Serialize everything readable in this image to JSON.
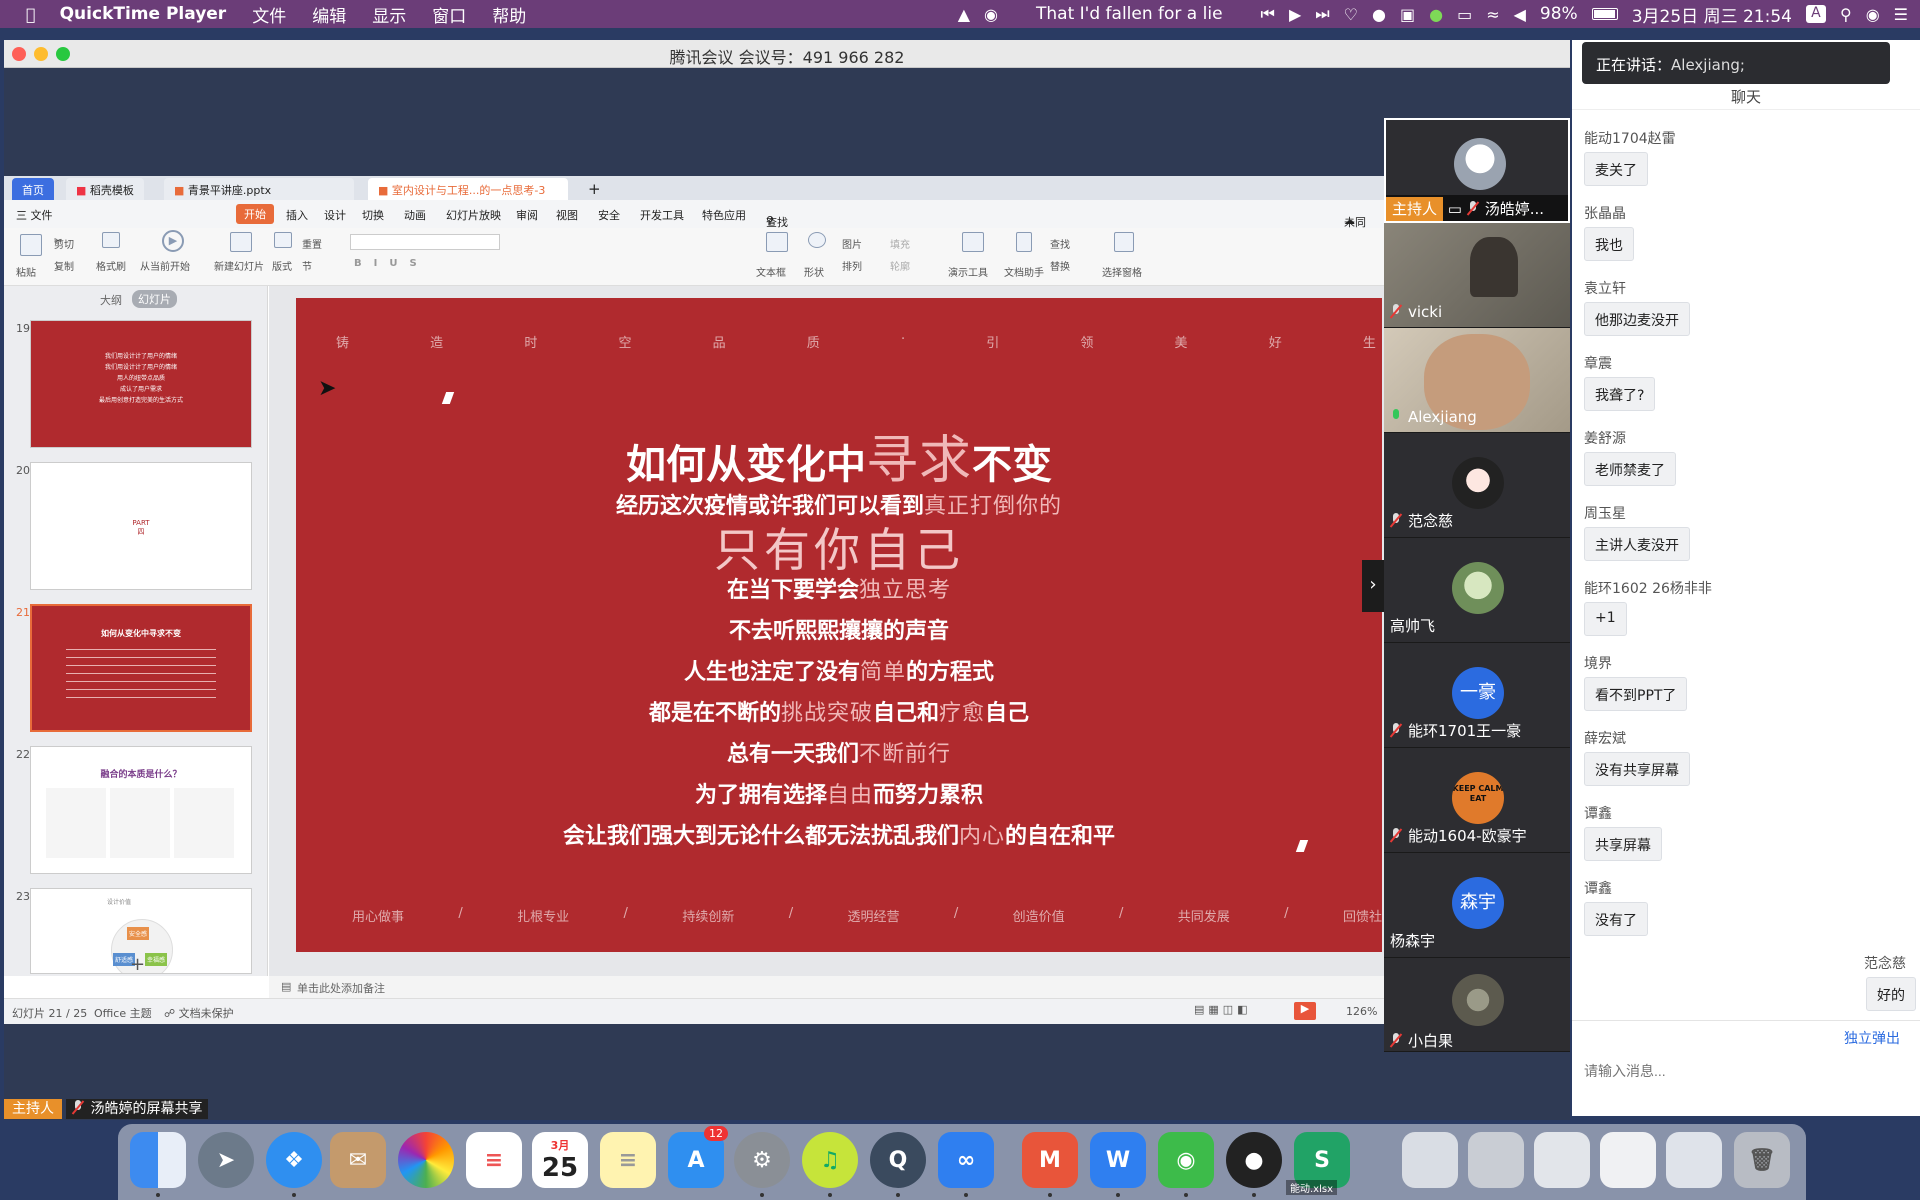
{
  "menubar": {
    "app_name": "QuickTime Player",
    "items": [
      "文件",
      "编辑",
      "显示",
      "窗口",
      "帮助"
    ],
    "now_playing": "That I'd fallen for a lie",
    "battery": "98%",
    "datetime": "3月25日 周三 21:54",
    "input_method": "A"
  },
  "window": {
    "title": "腾讯会议 会议号：491 966 282"
  },
  "wps": {
    "tabs": [
      "首页",
      "稻壳模板",
      "青景平讲座.pptx",
      "室内设计与工程...的一点思考-3"
    ],
    "menu": [
      "三 文件",
      "开始",
      "插入",
      "设计",
      "切换",
      "动画",
      "幻灯片放映",
      "审阅",
      "视图",
      "安全",
      "开发工具",
      "特色应用",
      "查找"
    ],
    "sync_label": "未同",
    "ribbon": {
      "paste": "粘贴",
      "cut": "剪切",
      "copy": "复制",
      "format_painter": "格式刷",
      "from_current": "从当前开始",
      "new_slide": "新建幻灯片",
      "layout": "版式",
      "reset": "重置",
      "section": "节",
      "textbox": "文本框",
      "shape": "形状",
      "picture": "图片",
      "arrange": "排列",
      "fill": "填充",
      "outline": "轮廓",
      "present_tool": "演示工具",
      "doc_helper": "文档助手",
      "find": "查找",
      "replace": "替换",
      "select_pane": "选择窗格"
    },
    "panel_tabs": [
      "大纲",
      "幻灯片"
    ],
    "thumbnails": [
      {
        "num": "19",
        "lines": [
          "我们用设计计了用户的情绪",
          "我们用设计计了用户的情绪",
          "用人的纽带点品质",
          "成认了用户需求",
          "最后用创意打造完美的生活方式"
        ]
      },
      {
        "num": "20",
        "lines": [
          "PART",
          "四"
        ]
      },
      {
        "num": "21",
        "lines": [
          "如何从变化中寻求不变"
        ]
      },
      {
        "num": "22",
        "lines": [
          "融合的本质是什么？"
        ]
      },
      {
        "num": "23",
        "lines": [
          "设计价值",
          "安全感",
          "舒适感",
          "幸福感"
        ]
      }
    ],
    "notes_placeholder": "单击此处添加备注",
    "status": {
      "slide_pos": "幻灯片 21 / 25",
      "theme": "Office 主题",
      "protect": "文档未保护",
      "zoom": "126%"
    }
  },
  "slide": {
    "top_slogan": [
      "铸",
      "造",
      "时",
      "空",
      "品",
      "质",
      "·",
      "引",
      "领",
      "美",
      "好",
      "生"
    ],
    "title_pre": "如何从变化中",
    "title_hl": "寻求",
    "title_post": "不变",
    "lines": [
      {
        "pre": "经历这次疫情或许我们可以看到",
        "hl": "真正打倒你的",
        "post": ""
      },
      {
        "pre": "在当下要学会",
        "hl": "独立思考",
        "post": ""
      },
      {
        "pre": "不去听熙熙攘攘的声音",
        "hl": "",
        "post": ""
      },
      {
        "pre": "人生也注定了没有",
        "hl": "简单",
        "post": "的方程式"
      },
      {
        "pre": "都是在不断的",
        "hl": "挑战突破",
        "post": "自己和",
        "hl2": "疗愈",
        "post2": "自己"
      },
      {
        "pre": "总有一天我们",
        "hl": "不断前行",
        "post": ""
      },
      {
        "pre": "为了拥有选择",
        "hl": "自由",
        "post": "而努力累积"
      },
      {
        "pre": "会让我们强大到无论什么都无法扰乱我们",
        "hl": "内心",
        "post": "的自在和平"
      }
    ],
    "big_line": "只有你自己",
    "bottom_slogan": [
      "用心做事",
      "/",
      "扎根专业",
      "/",
      "持续创新",
      "/",
      "透明经营",
      "/",
      "创造价值",
      "/",
      "共同发展",
      "/",
      "回馈社"
    ]
  },
  "participants": [
    {
      "name": "汤皓婷...",
      "role": "主持人",
      "mic": "off"
    },
    {
      "name": "vicki",
      "mic": "off"
    },
    {
      "name": "Alexjiang",
      "mic": "on"
    },
    {
      "name": "范念慈",
      "mic": "off"
    },
    {
      "name": "高帅飞",
      "mic": "none"
    },
    {
      "name": "能环1701王一豪",
      "mic": "off",
      "avatar_text": "一豪"
    },
    {
      "name": "能动1604-欧豪宇",
      "mic": "off",
      "avatar_text": "KEEP CALM EAT"
    },
    {
      "name": "杨森宇",
      "mic": "none",
      "avatar_text": "森宇"
    },
    {
      "name": "小白果",
      "mic": "off"
    }
  ],
  "share_bar": {
    "role": "主持人",
    "text": "汤皓婷的屏幕共享"
  },
  "chat": {
    "speaking": "正在讲话：",
    "speaking_name": "Alexjiang;",
    "header": "聊天",
    "messages": [
      {
        "name": "能动1704赵雷",
        "text": "麦关了"
      },
      {
        "name": "张晶晶",
        "text": "我也"
      },
      {
        "name": "袁立轩",
        "text": "他那边麦没开"
      },
      {
        "name": "章震",
        "text": "我聋了?"
      },
      {
        "name": "姜舒源",
        "text": "老师禁麦了"
      },
      {
        "name": "周玉星",
        "text": "主讲人麦没开"
      },
      {
        "name": "能环1602  26杨非非",
        "text": "+1"
      },
      {
        "name": "境界",
        "text": "看不到PPT了"
      },
      {
        "name": "薛宏斌",
        "text": "没有共享屏幕"
      },
      {
        "name": "谭鑫",
        "text": "共享屏幕"
      },
      {
        "name": "谭鑫",
        "text": "没有了"
      }
    ],
    "self_name": "范念慈",
    "self_text": "好的",
    "popout": "独立弹出",
    "input_placeholder": "请输入消息..."
  },
  "dock": {
    "calendar_month": "3月",
    "calendar_day": "25",
    "appstore_badge": "12",
    "xlsx_label": "能动.xlsx"
  },
  "colors": {
    "slide_red": "#b02a2e",
    "menubar": "#6b3d78",
    "wps_orange": "#e86b3a"
  }
}
